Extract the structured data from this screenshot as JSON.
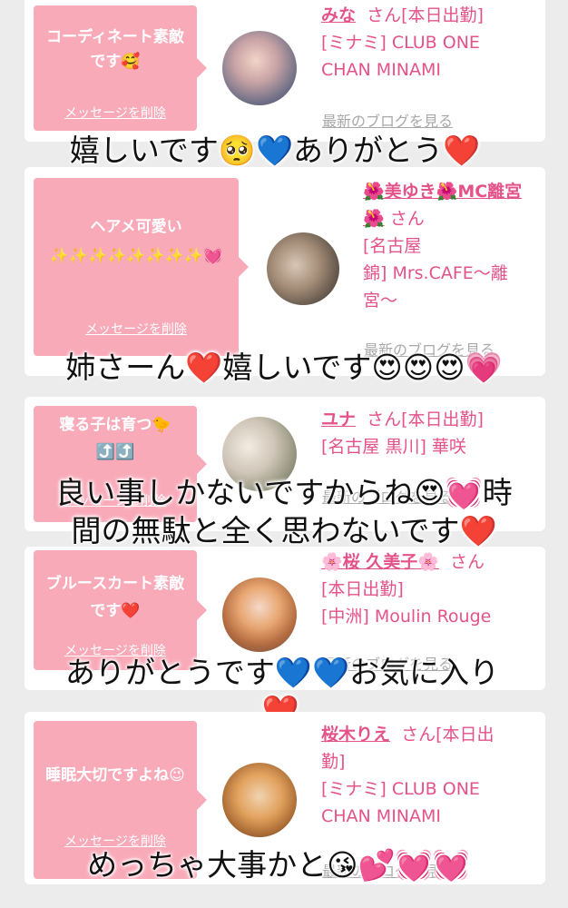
{
  "cards": [
    {
      "message": "コーディネート素敵です🥰",
      "delete_label": "メッセージを削除",
      "name": "みな",
      "san": "さん[本日出勤]",
      "lines": [
        "[ミナミ] CLUB ONE",
        "CHAN MINAMI"
      ],
      "blog_label": "最新のブログを見る",
      "overlay": "嬉しいです🥺💙ありがとう❤️"
    },
    {
      "message": "ヘアメ可愛い✨✨✨✨✨✨✨✨💓",
      "delete_label": "メッセージを削除",
      "name": "🌺美ゆき🌺MC離宮🌺",
      "san": "さん",
      "lines": [
        "[名古屋",
        "錦] Mrs.CAFE〜離",
        "宮〜"
      ],
      "blog_label": "最新のブログを見る",
      "overlay": "姉さーん❤️嬉しいです😍😍😍💗"
    },
    {
      "message": "寝る子は育つ🐤⤴️⤴️",
      "delete_label": "メッセージを削除",
      "name": "ユナ",
      "san": "さん[本日出勤]",
      "lines": [
        "[名古屋 黒川] 華咲"
      ],
      "blog_label": "最新のブログを見る",
      "overlay_line1": "良い事しかないですからね😍💓時",
      "overlay_line2": "間の無駄と全く思わないです❤️"
    },
    {
      "message": "ブルースカート素敵です❤️",
      "delete_label": "メッセージを削除",
      "name": "🌸桜 久美子🌸",
      "san": "さん",
      "lines": [
        "[本日出勤]",
        "[中洲] Moulin Rouge"
      ],
      "blog_label": "最新のブログを見る",
      "overlay_line1": "ありがとうです💙💙お気に入り",
      "overlay_line2": "❤️"
    },
    {
      "message": "睡眠大切ですよね😉",
      "delete_label": "メッセージを削除",
      "name": "桜木りえ",
      "san": "さん[本日出",
      "lines": [
        "勤]",
        "[ミナミ] CLUB ONE",
        "CHAN MINAMI"
      ],
      "blog_label": "最新のブログを見る",
      "overlay": "めっちゃ大事かと😘💕💓💓"
    }
  ],
  "colors": {
    "bubble": "#f9aab9",
    "accent": "#e3538a",
    "page_bg": "#ececec"
  }
}
